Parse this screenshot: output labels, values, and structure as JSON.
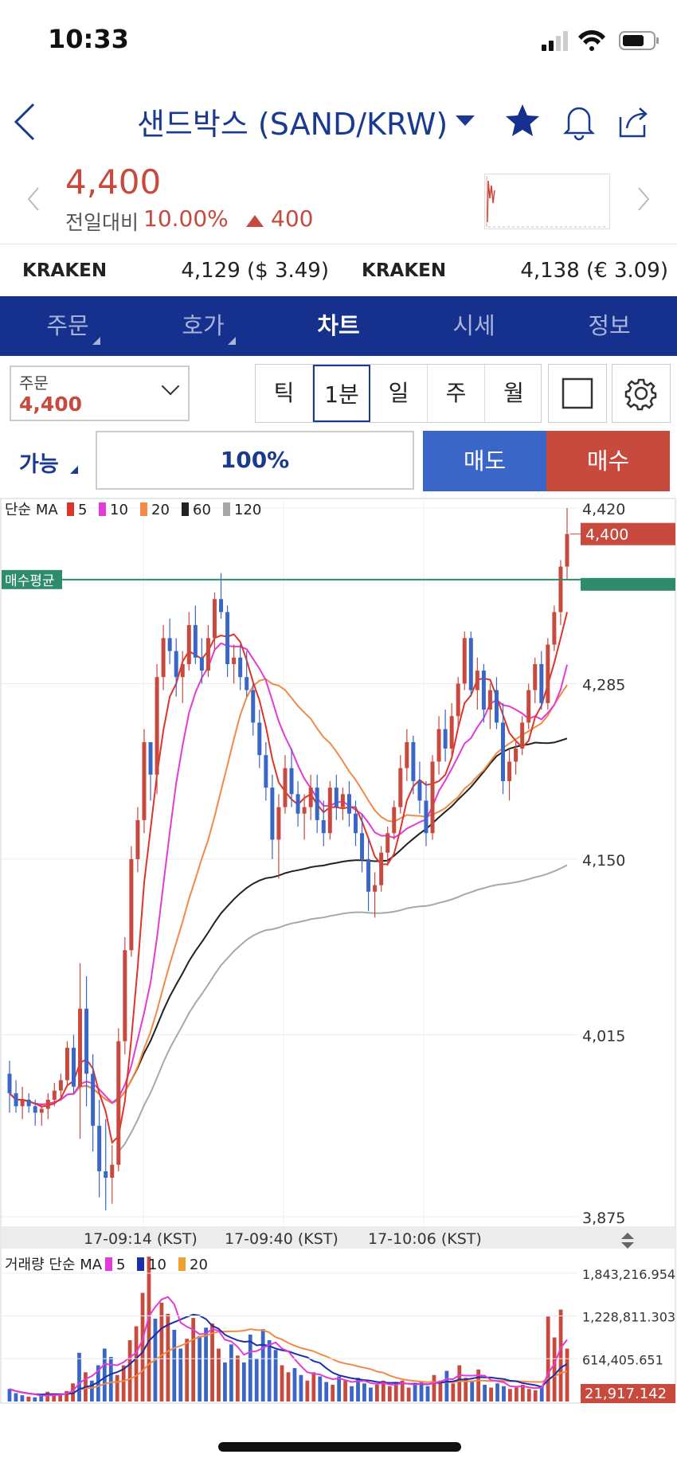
{
  "status": {
    "time": "10:33"
  },
  "header": {
    "title": "샌드박스 (SAND/KRW)"
  },
  "price": {
    "current": "4,400",
    "change_label": "전일대비",
    "change_pct": "10.00%",
    "change_abs": "400"
  },
  "exchanges": [
    {
      "name": "KRAKEN",
      "value": "4,129 ($ 3.49)"
    },
    {
      "name": "KRAKEN",
      "value": "4,138 (€ 3.09)"
    }
  ],
  "tabs": [
    {
      "label": "주문",
      "has_corner": true,
      "active": false
    },
    {
      "label": "호가",
      "has_corner": true,
      "active": false
    },
    {
      "label": "차트",
      "has_corner": false,
      "active": true
    },
    {
      "label": "시세",
      "has_corner": false,
      "active": false
    },
    {
      "label": "정보",
      "has_corner": false,
      "active": false
    }
  ],
  "order": {
    "label": "주문",
    "value": "4,400"
  },
  "periods": [
    {
      "label": "틱",
      "active": false
    },
    {
      "label": "1분",
      "active": true
    },
    {
      "label": "일",
      "active": false
    },
    {
      "label": "주",
      "active": false
    },
    {
      "label": "월",
      "active": false
    }
  ],
  "trade": {
    "available": "가능",
    "percent": "100%",
    "sell": "매도",
    "buy": "매수"
  },
  "colors": {
    "brand": "#15318d",
    "up": "#c8493d",
    "down": "#3a66c7",
    "avg_line": "#2e8b6e",
    "ma5": "#e0342b",
    "ma10": "#e23bd7",
    "ma20": "#f08a45",
    "ma60": "#222222",
    "ma120": "#a8a8a8"
  },
  "chart_data": [
    {
      "type": "candlestick",
      "legend_title": "단순 MA",
      "ma_periods": [
        "5",
        "10",
        "20",
        "60",
        "120"
      ],
      "avg_tag": "매수평균",
      "avg_price": 4365,
      "last_price_tag": "4,400",
      "y_ticks": [
        "4,420",
        "4,285",
        "4,150",
        "4,015",
        "3,875"
      ],
      "y_tick_values": [
        4420,
        4285,
        4150,
        4015,
        3875
      ],
      "ylim": [
        3875,
        4420
      ],
      "x_ticks": [
        "17-09:14 (KST)",
        "17-09:40 (KST)",
        "17-10:06 (KST)"
      ],
      "ohlc": [
        [
          3985,
          3995,
          3955,
          3970
        ],
        [
          3970,
          3980,
          3955,
          3960
        ],
        [
          3960,
          3975,
          3950,
          3965
        ],
        [
          3965,
          3970,
          3955,
          3960
        ],
        [
          3960,
          3965,
          3945,
          3955
        ],
        [
          3955,
          3962,
          3945,
          3958
        ],
        [
          3958,
          3970,
          3950,
          3965
        ],
        [
          3965,
          3978,
          3960,
          3972
        ],
        [
          3972,
          3985,
          3965,
          3980
        ],
        [
          3980,
          4010,
          3975,
          4005
        ],
        [
          4005,
          4015,
          3970,
          3975
        ],
        [
          3975,
          4070,
          3935,
          4035
        ],
        [
          4035,
          4060,
          3960,
          3985
        ],
        [
          3985,
          4000,
          3925,
          3945
        ],
        [
          3945,
          3965,
          3890,
          3910
        ],
        [
          3910,
          3950,
          3880,
          3905
        ],
        [
          3905,
          3930,
          3885,
          3915
        ],
        [
          3915,
          4020,
          3910,
          4010
        ],
        [
          4010,
          4090,
          4000,
          4080
        ],
        [
          4080,
          4160,
          4075,
          4150
        ],
        [
          4150,
          4190,
          4140,
          4180
        ],
        [
          4180,
          4250,
          4170,
          4240
        ],
        [
          4240,
          4230,
          4195,
          4215
        ],
        [
          4215,
          4300,
          4200,
          4290
        ],
        [
          4290,
          4330,
          4280,
          4320
        ],
        [
          4320,
          4335,
          4300,
          4310
        ],
        [
          4310,
          4320,
          4275,
          4290
        ],
        [
          4290,
          4310,
          4270,
          4300
        ],
        [
          4300,
          4340,
          4295,
          4330
        ],
        [
          4330,
          4345,
          4300,
          4305
        ],
        [
          4305,
          4320,
          4285,
          4295
        ],
        [
          4295,
          4330,
          4290,
          4320
        ],
        [
          4320,
          4355,
          4310,
          4350
        ],
        [
          4350,
          4370,
          4335,
          4340
        ],
        [
          4340,
          4345,
          4290,
          4300
        ],
        [
          4300,
          4315,
          4285,
          4305
        ],
        [
          4305,
          4315,
          4280,
          4290
        ],
        [
          4290,
          4310,
          4275,
          4280
        ],
        [
          4280,
          4285,
          4245,
          4255
        ],
        [
          4255,
          4265,
          4220,
          4230
        ],
        [
          4230,
          4240,
          4195,
          4205
        ],
        [
          4205,
          4215,
          4150,
          4165
        ],
        [
          4165,
          4200,
          4135,
          4190
        ],
        [
          4190,
          4230,
          4185,
          4220
        ],
        [
          4220,
          4235,
          4190,
          4200
        ],
        [
          4200,
          4210,
          4175,
          4185
        ],
        [
          4185,
          4200,
          4165,
          4190
        ],
        [
          4190,
          4215,
          4180,
          4205
        ],
        [
          4205,
          4215,
          4170,
          4180
        ],
        [
          4180,
          4195,
          4160,
          4170
        ],
        [
          4170,
          4210,
          4165,
          4205
        ],
        [
          4205,
          4215,
          4180,
          4190
        ],
        [
          4190,
          4205,
          4180,
          4200
        ],
        [
          4200,
          4210,
          4175,
          4185
        ],
        [
          4185,
          4195,
          4160,
          4170
        ],
        [
          4170,
          4185,
          4140,
          4150
        ],
        [
          4150,
          4165,
          4110,
          4125
        ],
        [
          4125,
          4140,
          4105,
          4130
        ],
        [
          4130,
          4160,
          4125,
          4155
        ],
        [
          4155,
          4175,
          4145,
          4170
        ],
        [
          4170,
          4195,
          4165,
          4190
        ],
        [
          4190,
          4230,
          4185,
          4220
        ],
        [
          4220,
          4250,
          4210,
          4240
        ],
        [
          4240,
          4245,
          4200,
          4210
        ],
        [
          4210,
          4225,
          4185,
          4195
        ],
        [
          4195,
          4210,
          4160,
          4170
        ],
        [
          4170,
          4230,
          4165,
          4225
        ],
        [
          4225,
          4260,
          4215,
          4250
        ],
        [
          4250,
          4265,
          4225,
          4235
        ],
        [
          4235,
          4270,
          4230,
          4260
        ],
        [
          4260,
          4290,
          4250,
          4285
        ],
        [
          4285,
          4325,
          4280,
          4320
        ],
        [
          4320,
          4325,
          4275,
          4280
        ],
        [
          4280,
          4305,
          4265,
          4295
        ],
        [
          4295,
          4300,
          4255,
          4265
        ],
        [
          4265,
          4285,
          4250,
          4280
        ],
        [
          4280,
          4290,
          4250,
          4255
        ],
        [
          4255,
          4270,
          4200,
          4210
        ],
        [
          4210,
          4235,
          4195,
          4225
        ],
        [
          4225,
          4240,
          4215,
          4235
        ],
        [
          4235,
          4260,
          4230,
          4255
        ],
        [
          4255,
          4285,
          4250,
          4280
        ],
        [
          4280,
          4305,
          4270,
          4300
        ],
        [
          4300,
          4310,
          4265,
          4270
        ],
        [
          4270,
          4320,
          4265,
          4315
        ],
        [
          4315,
          4345,
          4310,
          4340
        ],
        [
          4340,
          4380,
          4330,
          4375
        ],
        [
          4375,
          4420,
          4365,
          4400
        ]
      ]
    },
    {
      "type": "bar",
      "legend_title": "거래량 단순 MA",
      "ma_periods": [
        "5",
        "10",
        "20"
      ],
      "y_ticks": [
        "1,843,216.954",
        "1,228,811.303",
        "614,405.651"
      ],
      "y_tick_values": [
        1843216.954,
        1228811.303,
        614405.651
      ],
      "ylim": [
        0,
        2150000
      ],
      "last_volume_tag": "21,917.142",
      "volumes": [
        180000,
        120000,
        90000,
        70000,
        60000,
        80000,
        140000,
        110000,
        90000,
        150000,
        260000,
        700000,
        420000,
        300000,
        520000,
        760000,
        640000,
        380000,
        520000,
        880000,
        1080000,
        1560000,
        2080000,
        1190000,
        1420000,
        1260000,
        1030000,
        760000,
        900000,
        1200000,
        940000,
        1060000,
        1120000,
        760000,
        560000,
        820000,
        660000,
        560000,
        960000,
        620000,
        1040000,
        880000,
        740000,
        520000,
        420000,
        480000,
        380000,
        300000,
        420000,
        360000,
        280000,
        240000,
        360000,
        300000,
        220000,
        340000,
        260000,
        200000,
        240000,
        300000,
        220000,
        260000,
        300000,
        200000,
        240000,
        280000,
        220000,
        380000,
        300000,
        440000,
        260000,
        520000,
        340000,
        300000,
        460000,
        240000,
        200000,
        260000,
        220000,
        180000,
        200000,
        240000,
        180000,
        160000,
        220000,
        1220000,
        920000,
        1320000,
        760000
      ]
    }
  ]
}
